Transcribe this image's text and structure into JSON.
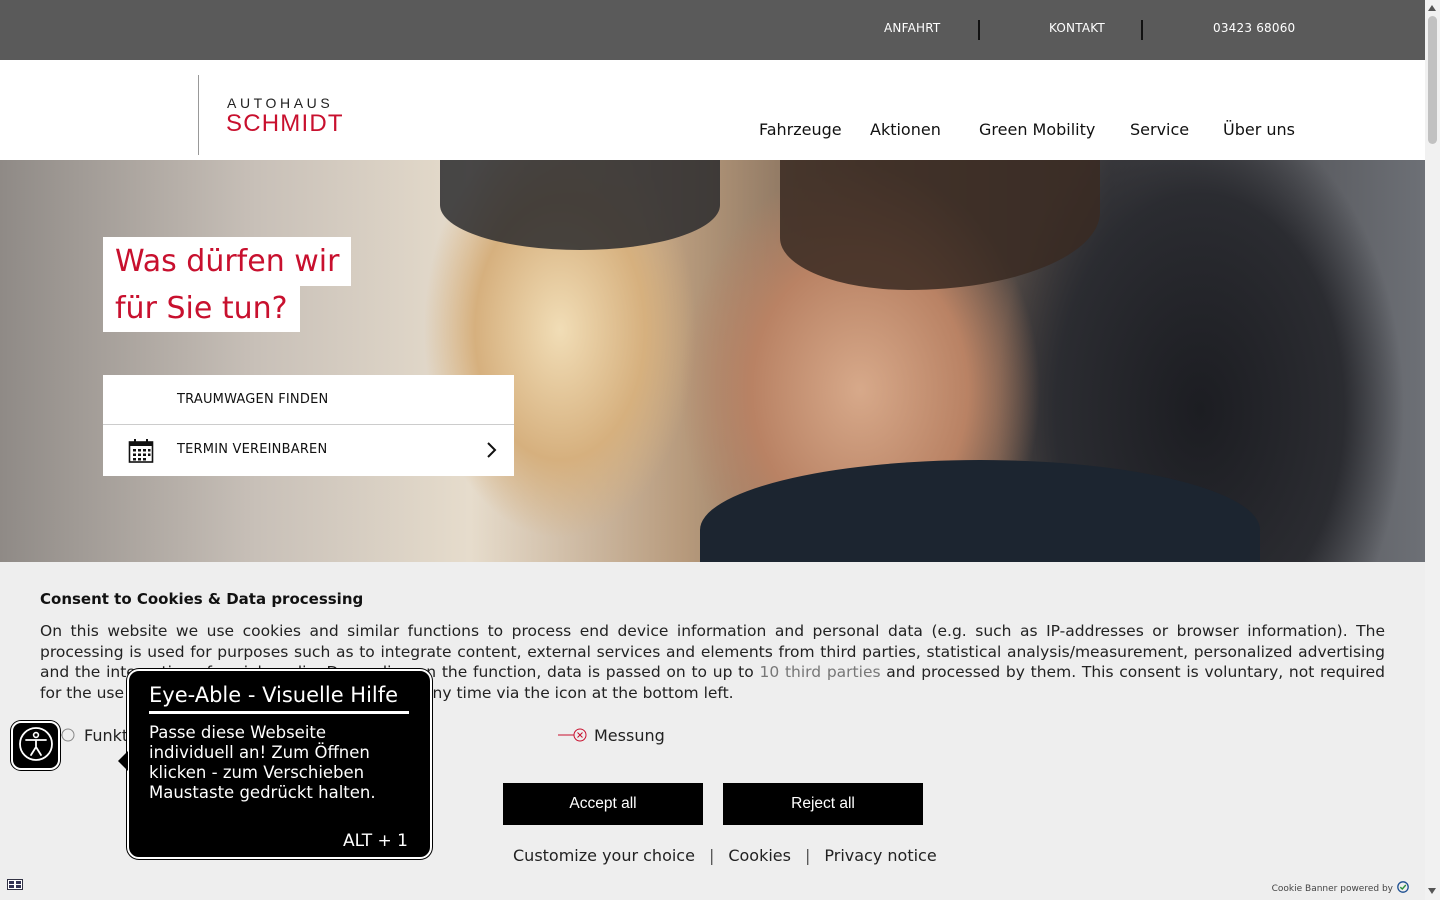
{
  "topbar": {
    "directions": "ANFAHRT",
    "contact": "KONTAKT",
    "phone": "03423 68060"
  },
  "logo": {
    "line1": "AUTOHAUS",
    "line2": "SCHMIDT"
  },
  "nav": {
    "items": [
      "Fahrzeuge",
      "Aktionen",
      "Green Mobility",
      "Service",
      "Über uns"
    ]
  },
  "hero": {
    "headline_line1": "Was dürfen wir",
    "headline_line2": "für Sie tun?",
    "cta_find": "TRAUMWAGEN FINDEN",
    "cta_appointment": "TERMIN VEREINBAREN"
  },
  "cookie": {
    "title": "Consent to Cookies & Data processing",
    "text_part1": "On this website we use cookies and similar functions to process end device information and personal data (e.g. such as IP-addresses or browser information). The processing is used for purposes such as to integrate content, external services and elements from third parties, statistical analysis/measurement, personalized advertising and the integration of social media. Depending on the function, data is passed on to up to ",
    "text_link": "10 third parties",
    "text_part2": " and processed by them. This consent is voluntary, not required for the use of our website and can be revoked at any time via the icon at the bottom left.",
    "toggle_functional": "Funktional",
    "toggle_measurement": "Messung",
    "accept_all": "Accept all",
    "reject_all": "Reject all",
    "customize": "Customize your choice",
    "cookies_link": "Cookies",
    "privacy_link": "Privacy notice",
    "powered_by": "Cookie Banner powered by"
  },
  "eyeable": {
    "title": "Eye-Able - Visuelle Hilfe",
    "body": "Passe diese Webseite individuell an! Zum Öffnen klicken - zum Verschieben Maustaste gedrückt halten.",
    "shortcut": "ALT + 1"
  },
  "colors": {
    "brand_red": "#c8102e",
    "topbar_bg": "#5a5a5a",
    "banner_bg": "#eeeeee"
  },
  "icons": {
    "calendar": "calendar-icon",
    "chevron": "chevron-right-icon",
    "accessibility": "accessibility-person-icon",
    "toggle_off": "toggle-off-icon",
    "consent_check": "checkmark-shield-icon"
  }
}
